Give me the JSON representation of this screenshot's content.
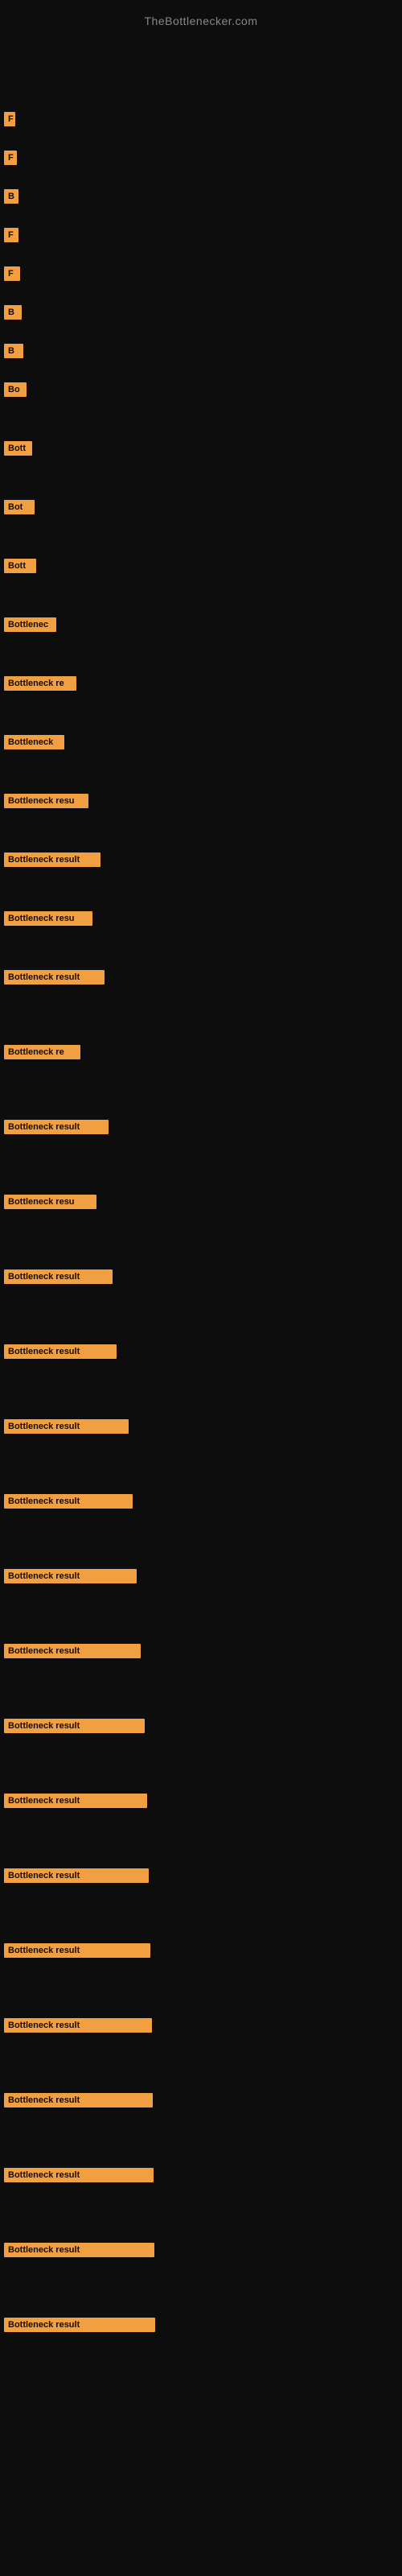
{
  "site_title": "TheBottlenecker.com",
  "bars": [
    {
      "id": 1,
      "label": "",
      "width": 8
    },
    {
      "id": 2,
      "label": "",
      "width": 10
    },
    {
      "id": 3,
      "label": "F",
      "width": 14
    },
    {
      "id": 4,
      "label": "F",
      "width": 16
    },
    {
      "id": 5,
      "label": "B",
      "width": 18
    },
    {
      "id": 6,
      "label": "F",
      "width": 18
    },
    {
      "id": 7,
      "label": "F",
      "width": 20
    },
    {
      "id": 8,
      "label": "B",
      "width": 22
    },
    {
      "id": 9,
      "label": "B",
      "width": 24
    },
    {
      "id": 10,
      "label": "Bo",
      "width": 28
    },
    {
      "id": 11,
      "label": "Bott",
      "width": 35
    },
    {
      "id": 12,
      "label": "Bot",
      "width": 38
    },
    {
      "id": 13,
      "label": "Bott",
      "width": 40
    },
    {
      "id": 14,
      "label": "Bottlenec",
      "width": 65
    },
    {
      "id": 15,
      "label": "Bottleneck re",
      "width": 90
    },
    {
      "id": 16,
      "label": "Bottleneck",
      "width": 75
    },
    {
      "id": 17,
      "label": "Bottleneck resu",
      "width": 105
    },
    {
      "id": 18,
      "label": "Bottleneck result",
      "width": 120
    },
    {
      "id": 19,
      "label": "Bottleneck resu",
      "width": 110
    },
    {
      "id": 20,
      "label": "Bottleneck result",
      "width": 125
    },
    {
      "id": 21,
      "label": "Bottleneck re",
      "width": 95
    },
    {
      "id": 22,
      "label": "Bottleneck result",
      "width": 130
    },
    {
      "id": 23,
      "label": "Bottleneck resu",
      "width": 115
    },
    {
      "id": 24,
      "label": "Bottleneck result",
      "width": 135
    },
    {
      "id": 25,
      "label": "Bottleneck result",
      "width": 140
    },
    {
      "id": 26,
      "label": "Bottleneck result",
      "width": 155
    },
    {
      "id": 27,
      "label": "Bottleneck result",
      "width": 160
    },
    {
      "id": 28,
      "label": "Bottleneck result",
      "width": 165
    },
    {
      "id": 29,
      "label": "Bottleneck result",
      "width": 170
    },
    {
      "id": 30,
      "label": "Bottleneck result",
      "width": 175
    },
    {
      "id": 31,
      "label": "Bottleneck result",
      "width": 178
    },
    {
      "id": 32,
      "label": "Bottleneck result",
      "width": 180
    },
    {
      "id": 33,
      "label": "Bottleneck result",
      "width": 182
    },
    {
      "id": 34,
      "label": "Bottleneck result",
      "width": 184
    },
    {
      "id": 35,
      "label": "Bottleneck result",
      "width": 185
    },
    {
      "id": 36,
      "label": "Bottleneck result",
      "width": 186
    },
    {
      "id": 37,
      "label": "Bottleneck result",
      "width": 187
    },
    {
      "id": 38,
      "label": "Bottleneck result",
      "width": 188
    }
  ]
}
